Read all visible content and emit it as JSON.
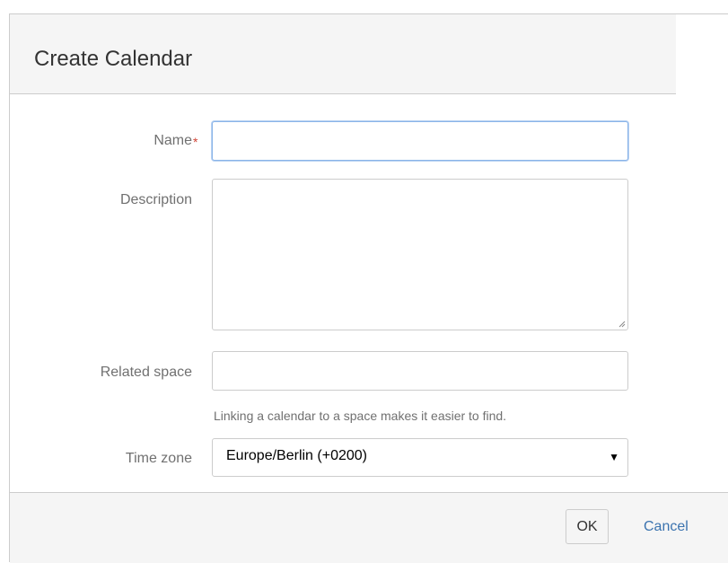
{
  "dialog": {
    "title": "Create Calendar"
  },
  "form": {
    "name_label": "Name",
    "required_marker": "*",
    "name_value": "",
    "description_label": "Description",
    "description_value": "",
    "related_space_label": "Related space",
    "related_space_value": "",
    "related_space_help": "Linking a calendar to a space makes it easier to find.",
    "time_zone_label": "Time zone",
    "time_zone_selected": "Europe/Berlin (+0200)"
  },
  "footer": {
    "ok_label": "OK",
    "cancel_label": "Cancel"
  },
  "colors": {
    "header_bg": "#f5f5f5",
    "required": "#d04437",
    "link": "#3b73af",
    "focus_border": "#8ab4e8"
  }
}
